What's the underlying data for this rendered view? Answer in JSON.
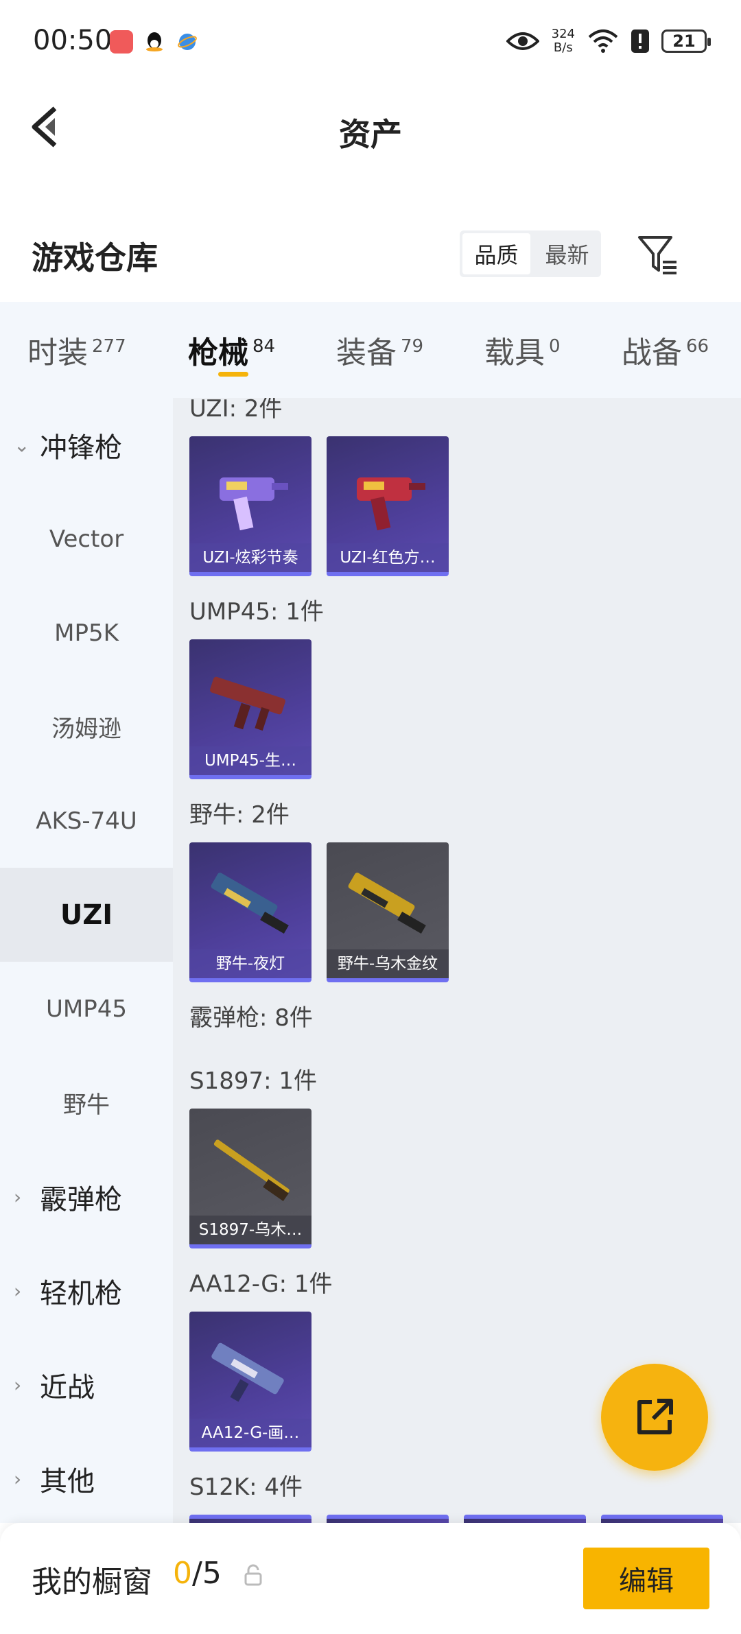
{
  "status_bar": {
    "time": "00:50",
    "net_speed_value": "324",
    "net_speed_unit": "B/s",
    "battery": "21",
    "icons": [
      "notification-app-icon",
      "qq-icon",
      "browser-icon",
      "eye-icon",
      "wifi-icon",
      "alert-icon",
      "battery-icon"
    ]
  },
  "header": {
    "title": "资产",
    "back_icon": "chevron-left-icon"
  },
  "warehouse": {
    "title": "游戏仓库",
    "sort_options": [
      "品质",
      "最新"
    ],
    "sort_selected": "品质",
    "filter_icon": "filter-icon"
  },
  "category_tabs": [
    {
      "label": "时装",
      "count": "277",
      "active": false
    },
    {
      "label": "枪械",
      "count": "84",
      "active": true
    },
    {
      "label": "装备",
      "count": "79",
      "active": false
    },
    {
      "label": "载具",
      "count": "0",
      "active": false
    },
    {
      "label": "战备",
      "count": "66",
      "active": false
    }
  ],
  "sidebar": [
    {
      "label": "冲锋枪",
      "type": "group",
      "expanded": true
    },
    {
      "label": "Vector",
      "type": "sub"
    },
    {
      "label": "MP5K",
      "type": "sub"
    },
    {
      "label": "汤姆逊",
      "type": "sub"
    },
    {
      "label": "AKS-74U",
      "type": "sub"
    },
    {
      "label": "UZI",
      "type": "sub",
      "active": true
    },
    {
      "label": "UMP45",
      "type": "sub"
    },
    {
      "label": "野牛",
      "type": "sub"
    },
    {
      "label": "霰弹枪",
      "type": "group",
      "expanded": false
    },
    {
      "label": "轻机枪",
      "type": "group",
      "expanded": false
    },
    {
      "label": "近战",
      "type": "group",
      "expanded": false
    },
    {
      "label": "其他",
      "type": "group",
      "expanded": false
    }
  ],
  "sections": [
    {
      "label": "UZI: 2件",
      "items": [
        {
          "name": "UZI-炫彩节奏",
          "rarity": "purple"
        },
        {
          "name": "UZI-红色方…",
          "rarity": "purple"
        }
      ]
    },
    {
      "label": "UMP45: 1件",
      "items": [
        {
          "name": "UMP45-生…",
          "rarity": "purple"
        }
      ]
    },
    {
      "label": "野牛: 2件",
      "items": [
        {
          "name": "野牛-夜灯",
          "rarity": "purple"
        },
        {
          "name": "野牛-乌木金纹",
          "rarity": "gray"
        }
      ]
    },
    {
      "label": "霰弹枪: 8件",
      "items": []
    },
    {
      "label": "S1897: 1件",
      "items": [
        {
          "name": "S1897-乌木…",
          "rarity": "gray"
        }
      ]
    },
    {
      "label": "AA12-G: 1件",
      "items": [
        {
          "name": "AA12-G-画…",
          "rarity": "purple"
        }
      ]
    },
    {
      "label": "S12K: 4件",
      "items": []
    }
  ],
  "fab": {
    "icon": "share-external-icon"
  },
  "bottom_bar": {
    "label": "我的橱窗",
    "current": "0",
    "separator": "/",
    "total": "5",
    "lock_icon": "lock-icon",
    "edit_label": "编辑"
  },
  "colors": {
    "accent": "#f5b30b",
    "purple_card": "#4e3f9a",
    "gray_card": "#55555c",
    "sidebar_bg": "#f3f7fc",
    "content_bg": "#eceff3"
  }
}
